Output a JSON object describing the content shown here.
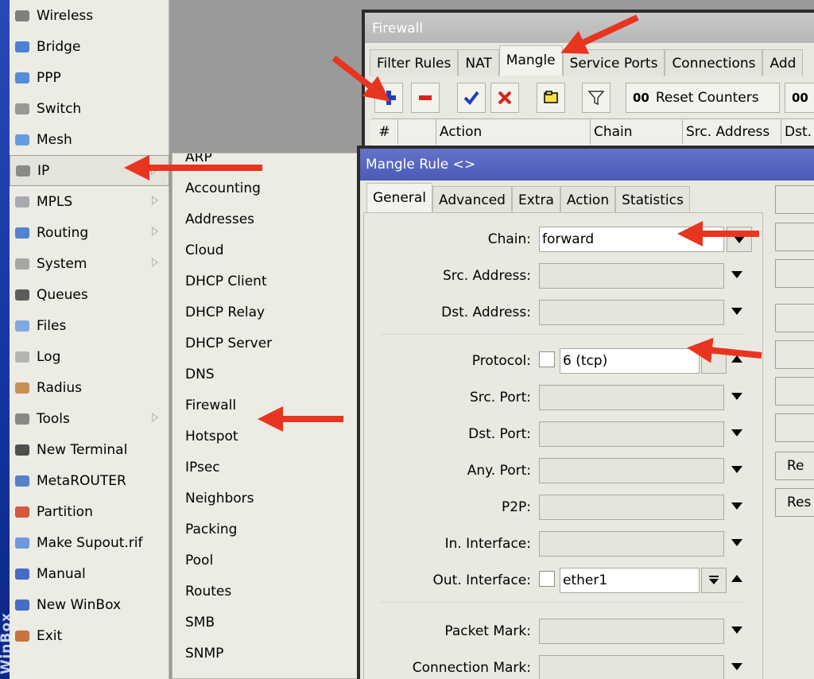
{
  "sidebar_brand": "WinBox",
  "main_menu": [
    {
      "label": "Wireless",
      "icon": "wireless-icon",
      "arrow": false
    },
    {
      "label": "Bridge",
      "icon": "bridge-icon",
      "arrow": false
    },
    {
      "label": "PPP",
      "icon": "ppp-icon",
      "arrow": false
    },
    {
      "label": "Switch",
      "icon": "switch-icon",
      "arrow": false
    },
    {
      "label": "Mesh",
      "icon": "mesh-icon",
      "arrow": false
    },
    {
      "label": "IP",
      "icon": "ip-icon",
      "arrow": true,
      "selected": true
    },
    {
      "label": "MPLS",
      "icon": "mpls-icon",
      "arrow": true
    },
    {
      "label": "Routing",
      "icon": "routing-icon",
      "arrow": true
    },
    {
      "label": "System",
      "icon": "system-icon",
      "arrow": true
    },
    {
      "label": "Queues",
      "icon": "queues-icon",
      "arrow": false
    },
    {
      "label": "Files",
      "icon": "files-icon",
      "arrow": false
    },
    {
      "label": "Log",
      "icon": "log-icon",
      "arrow": false
    },
    {
      "label": "Radius",
      "icon": "radius-icon",
      "arrow": false
    },
    {
      "label": "Tools",
      "icon": "tools-icon",
      "arrow": true
    },
    {
      "label": "New Terminal",
      "icon": "terminal-icon",
      "arrow": false
    },
    {
      "label": "MetaROUTER",
      "icon": "metarouter-icon",
      "arrow": false
    },
    {
      "label": "Partition",
      "icon": "partition-icon",
      "arrow": false
    },
    {
      "label": "Make Supout.rif",
      "icon": "supout-icon",
      "arrow": false
    },
    {
      "label": "Manual",
      "icon": "manual-icon",
      "arrow": false
    },
    {
      "label": "New WinBox",
      "icon": "winbox-icon",
      "arrow": false
    },
    {
      "label": "Exit",
      "icon": "exit-icon",
      "arrow": false
    }
  ],
  "ip_submenu": [
    "ARP",
    "Accounting",
    "Addresses",
    "Cloud",
    "DHCP Client",
    "DHCP Relay",
    "DHCP Server",
    "DNS",
    "Firewall",
    "Hotspot",
    "IPsec",
    "Neighbors",
    "Packing",
    "Pool",
    "Routes",
    "SMB",
    "SNMP"
  ],
  "firewall": {
    "title": "Firewall",
    "tabs": [
      "Filter Rules",
      "NAT",
      "Mangle",
      "Service Ports",
      "Connections",
      "Add"
    ],
    "active_tab": "Mangle",
    "reset_counters_prefix": "00",
    "reset_counters_label": "Reset Counters",
    "reset_all_prefix": "00",
    "columns": [
      "#",
      "",
      "Action",
      "Chain",
      "Src. Address",
      "Dst."
    ]
  },
  "mangle_rule": {
    "title": "Mangle Rule <>",
    "tabs": [
      "General",
      "Advanced",
      "Extra",
      "Action",
      "Statistics"
    ],
    "active_tab": "General",
    "fields": {
      "chain": {
        "label": "Chain:",
        "value": "forward"
      },
      "src_address": {
        "label": "Src. Address:",
        "value": ""
      },
      "dst_address": {
        "label": "Dst. Address:",
        "value": ""
      },
      "protocol": {
        "label": "Protocol:",
        "value": "6 (tcp)"
      },
      "src_port": {
        "label": "Src. Port:",
        "value": ""
      },
      "dst_port": {
        "label": "Dst. Port:",
        "value": ""
      },
      "any_port": {
        "label": "Any. Port:",
        "value": ""
      },
      "p2p": {
        "label": "P2P:",
        "value": ""
      },
      "in_interface": {
        "label": "In. Interface:",
        "value": ""
      },
      "out_interface": {
        "label": "Out. Interface:",
        "value": "ether1"
      },
      "packet_mark": {
        "label": "Packet Mark:",
        "value": ""
      },
      "connection_mark": {
        "label": "Connection Mark:",
        "value": ""
      }
    },
    "side_buttons": [
      "",
      "",
      "",
      "",
      "",
      "",
      "",
      "Re",
      "Res"
    ]
  },
  "colors": {
    "annotation": "#e8351f",
    "dialog_title": "#5565bf"
  }
}
